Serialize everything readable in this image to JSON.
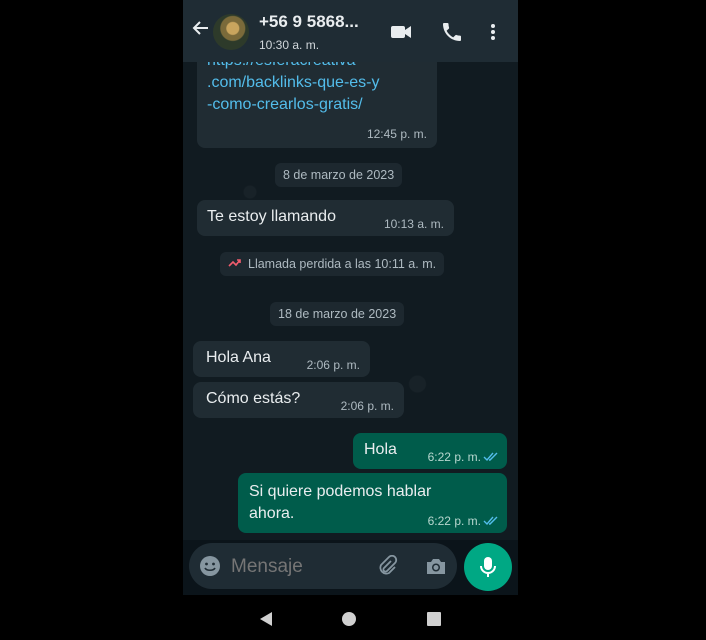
{
  "header": {
    "contact_name": "+56 9 5868...",
    "last_seen": "10:30 a. m."
  },
  "messages": {
    "link": {
      "lines": [
        "https://esferacreativa",
        ".com/backlinks-que-es-y",
        "-como-crearlos-gratis/"
      ],
      "time": "12:45 p. m."
    },
    "date1": "8 de marzo de 2023",
    "m1": {
      "text": "Te estoy llamando",
      "time": "10:13 a. m."
    },
    "missed_call": "Llamada perdida a las 10:11 a. m.",
    "date2": "18 de marzo de 2023",
    "m2": {
      "text": "Hola Ana",
      "time": "2:06 p. m."
    },
    "m3": {
      "text": "Cómo estás?",
      "time": "2:06 p. m."
    },
    "m4": {
      "text": "Hola",
      "time": "6:22 p. m."
    },
    "m5": {
      "line1": "Si quiere podemos hablar",
      "line2": "ahora.",
      "time": "6:22 p. m."
    }
  },
  "input": {
    "placeholder": "Mensaje"
  },
  "colors": {
    "incoming_bubble": "#202c33",
    "outgoing_bubble": "#005c4b",
    "accent": "#00a884",
    "read_ticks": "#53bdeb"
  }
}
